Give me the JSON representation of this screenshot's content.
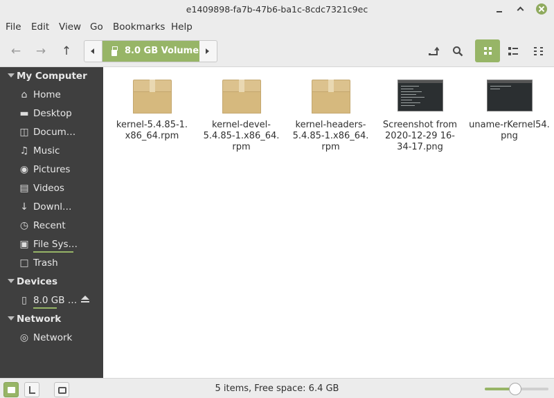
{
  "window": {
    "title": "e1409898-fa7b-47b6-ba1c-8cdc7321c9ec"
  },
  "menubar": {
    "items": [
      "File",
      "Edit",
      "View",
      "Go",
      "Bookmarks",
      "Help"
    ]
  },
  "toolbar": {
    "path_segment": "8.0 GB Volume",
    "active_view": "icon-view"
  },
  "sidebar": {
    "sections": [
      {
        "label": "My Computer",
        "items": [
          {
            "label": "Home",
            "icon": "home-icon"
          },
          {
            "label": "Desktop",
            "icon": "desktop-icon"
          },
          {
            "label": "Docum…",
            "icon": "document-icon"
          },
          {
            "label": "Music",
            "icon": "music-icon"
          },
          {
            "label": "Pictures",
            "icon": "camera-icon"
          },
          {
            "label": "Videos",
            "icon": "film-icon"
          },
          {
            "label": "Downl…",
            "icon": "download-icon"
          },
          {
            "label": "Recent",
            "icon": "clock-icon"
          },
          {
            "label": "File Sys…",
            "icon": "drive-icon"
          },
          {
            "label": "Trash",
            "icon": "trash-icon"
          }
        ]
      },
      {
        "label": "Devices",
        "items": [
          {
            "label": "8.0 GB …",
            "icon": "usb-drive-icon"
          }
        ]
      },
      {
        "label": "Network",
        "items": [
          {
            "label": "Network",
            "icon": "network-icon"
          }
        ]
      }
    ]
  },
  "files": [
    {
      "name": "kernel-5.4.85-1.x86_64.rpm",
      "lines": [
        "kernel-5.4.85-1.",
        "x86_64.rpm"
      ],
      "type": "package"
    },
    {
      "name": "kernel-devel-5.4.85-1.x86_64.rpm",
      "lines": [
        "kernel-devel-",
        "5.4.85-1.x86_64.",
        "rpm"
      ],
      "type": "package"
    },
    {
      "name": "kernel-headers-5.4.85-1.x86_64.rpm",
      "lines": [
        "kernel-headers-",
        "5.4.85-1.x86_64.",
        "rpm"
      ],
      "type": "package"
    },
    {
      "name": "Screenshot from 2020-12-29 16-34-17.png",
      "lines": [
        "Screenshot from",
        "2020-12-29 16-",
        "34-17.png"
      ],
      "type": "image"
    },
    {
      "name": "uname-rKernel54.png",
      "lines": [
        "uname-rKernel54.",
        "png"
      ],
      "type": "image"
    }
  ],
  "status": {
    "text": "5 items, Free space: 6.4 GB",
    "zoom_level": 0.48
  },
  "colors": {
    "accent": "#97b567",
    "sidebar_bg": "#3f3f3f"
  }
}
